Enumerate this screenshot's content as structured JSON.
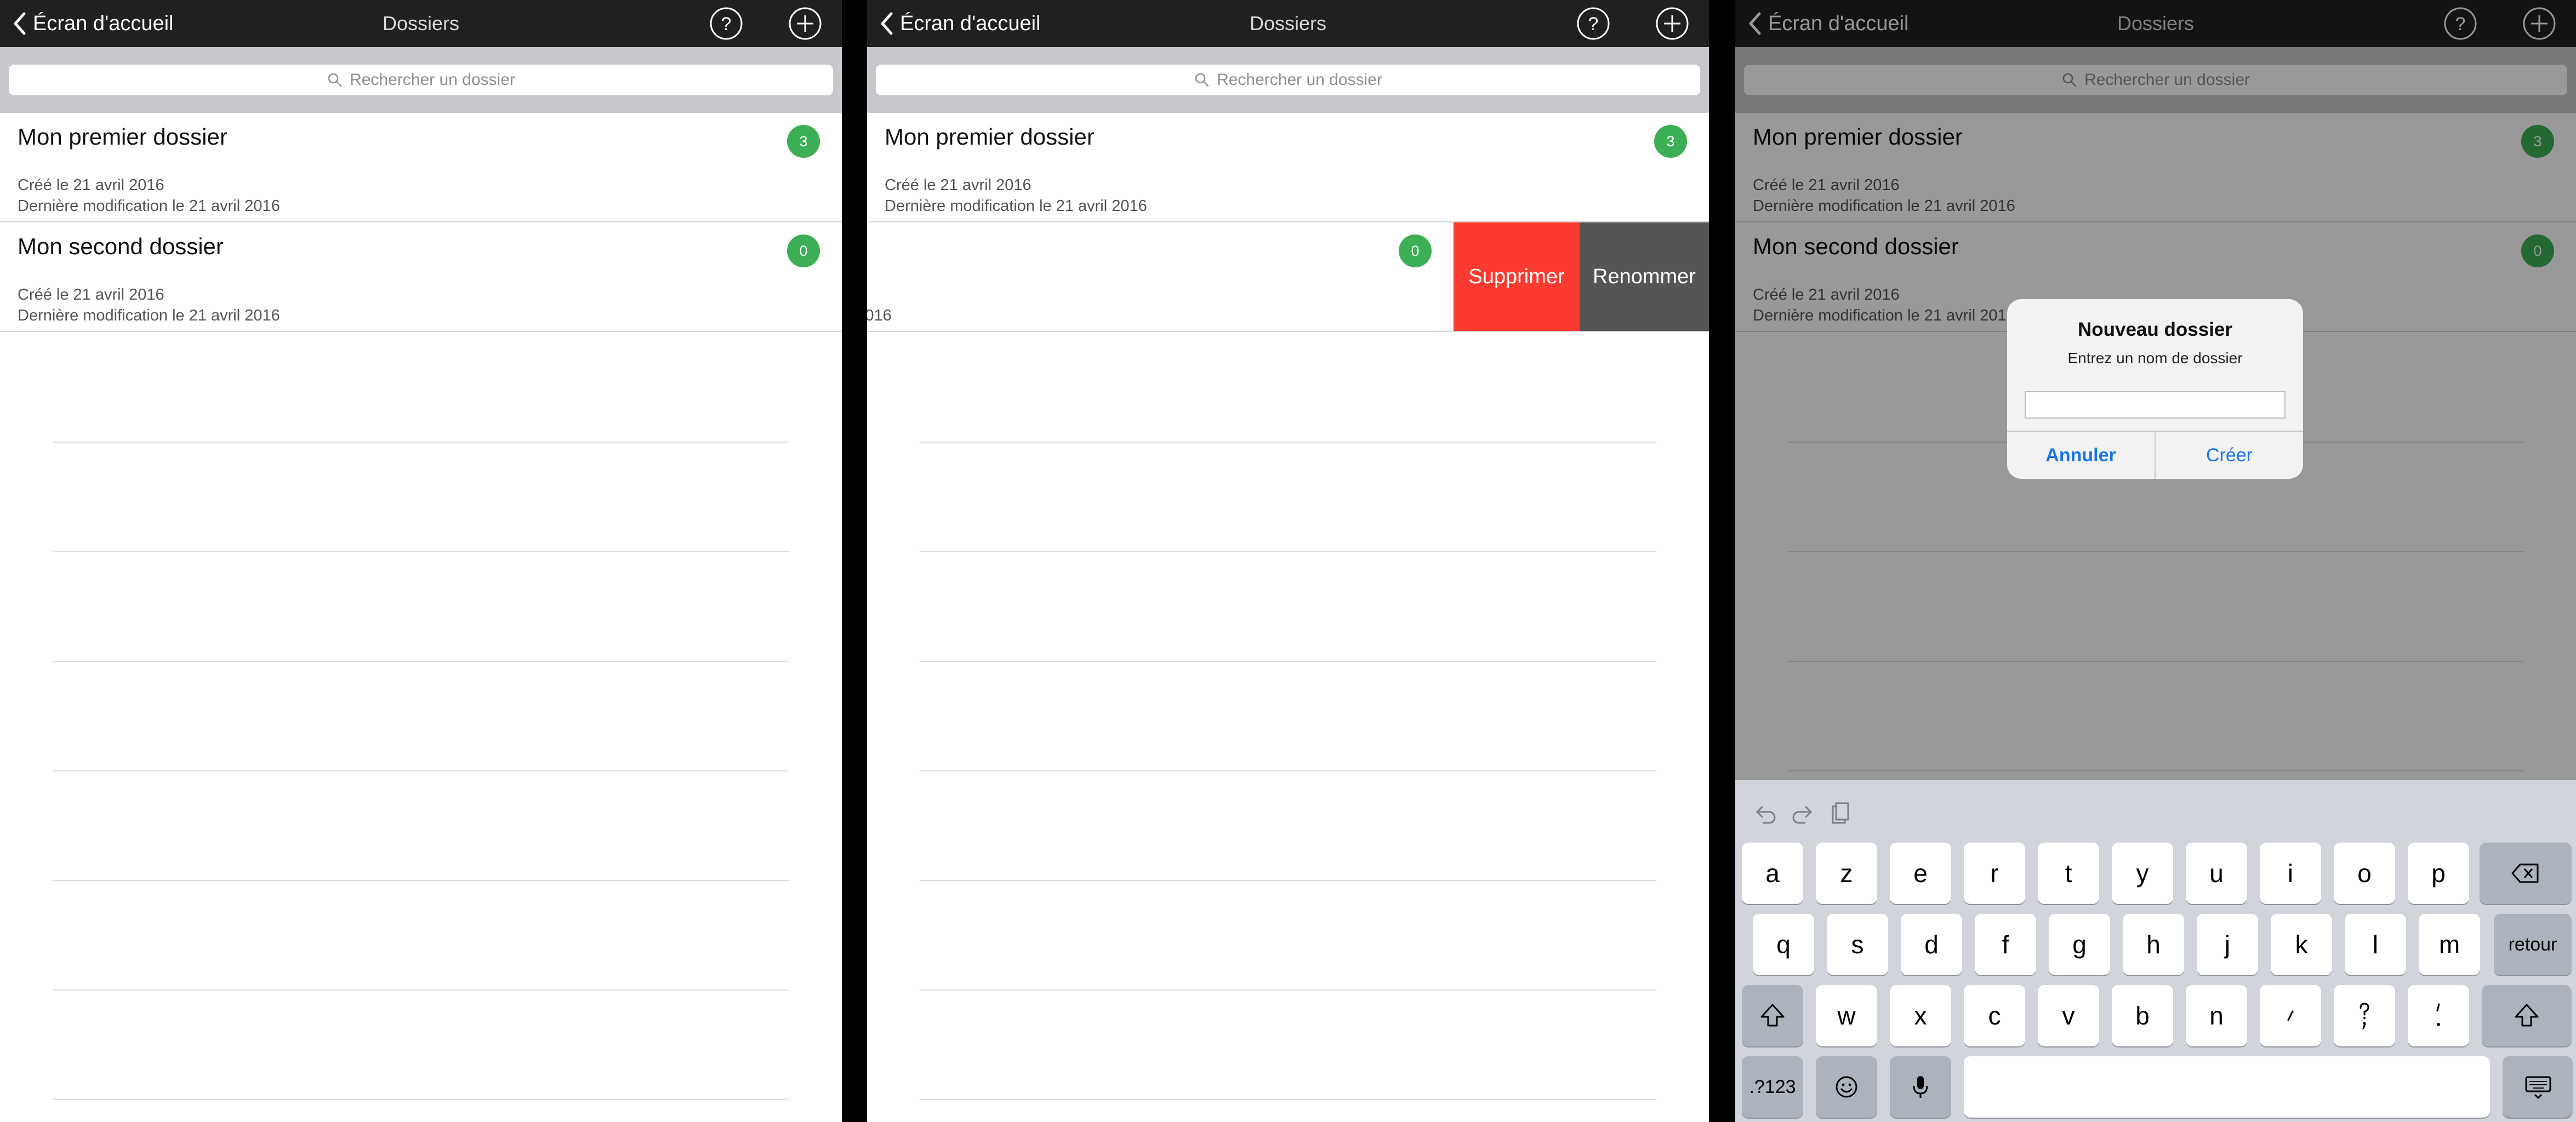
{
  "nav": {
    "back_label": "Écran d'accueil",
    "title": "Dossiers",
    "help_icon": "help-circle-icon",
    "add_icon": "add-circle-icon"
  },
  "search": {
    "placeholder": "Rechercher un dossier"
  },
  "folders": [
    {
      "name": "Mon premier dossier",
      "created": "Créé le 21 avril 2016",
      "modified": "Dernière modification le 21 avril 2016",
      "count": "3"
    },
    {
      "name": "Mon second dossier",
      "created": "Créé le 21 avril 2016",
      "modified": "Dernière modification le 21 avril 2016",
      "count": "0"
    }
  ],
  "swipe_actions": {
    "delete": "Supprimer",
    "rename": "Renommer"
  },
  "alert": {
    "title": "Nouveau dossier",
    "message": "Entrez un nom de dossier",
    "cancel": "Annuler",
    "create": "Créer"
  },
  "keyboard": {
    "row1": [
      "a",
      "z",
      "e",
      "r",
      "t",
      "y",
      "u",
      "i",
      "o",
      "p"
    ],
    "row2": [
      "q",
      "s",
      "d",
      "f",
      "g",
      "h",
      "j",
      "k",
      "l",
      "m"
    ],
    "row3": [
      "w",
      "x",
      "c",
      "v",
      "b",
      "n"
    ],
    "return_label": "retour",
    "numbers_label": ".?123"
  },
  "colors": {
    "navbar": "#202020",
    "badge": "#3cae55",
    "delete": "#fb3a30",
    "rename": "#555555",
    "alert_button": "#1a73e8"
  }
}
